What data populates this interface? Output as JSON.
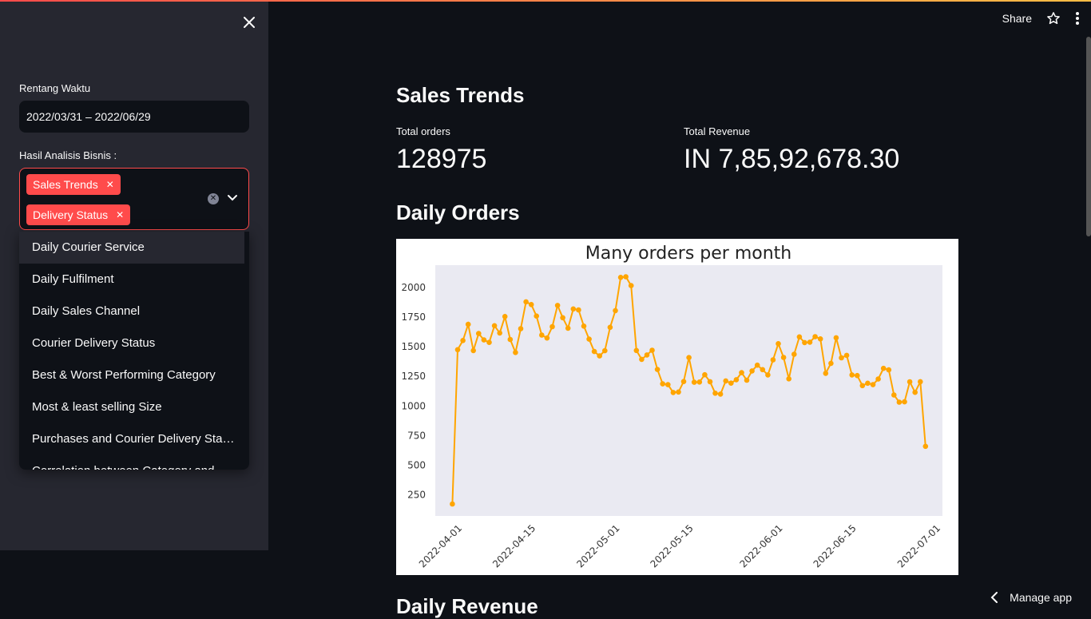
{
  "header": {
    "share_label": "Share"
  },
  "sidebar": {
    "date_label": "Rentang Waktu",
    "date_value": "2022/03/31 – 2022/06/29",
    "analysis_label": "Hasil Analisis Bisnis :",
    "selected_tags": [
      "Sales Trends",
      "Delivery Status"
    ],
    "options": [
      "Daily Courier Service",
      "Daily Fulfilment",
      "Daily Sales Channel",
      "Courier Delivery Status",
      "Best & Worst Performing Category",
      "Most & least selling Size",
      "Purchases and Courier Delivery Sta…",
      "Correlation between Category and"
    ]
  },
  "main": {
    "title": "Sales Trends",
    "metrics": [
      {
        "label": "Total orders",
        "value": "128975"
      },
      {
        "label": "Total Revenue",
        "value": "IN 7,85,92,678.30"
      }
    ],
    "daily_orders_heading": "Daily Orders",
    "daily_revenue_heading": "Daily Revenue"
  },
  "footer": {
    "manage_label": "Manage app"
  },
  "colors": {
    "accent": "#ff4b4b",
    "line": "#ffa500",
    "plot_bg": "#eaeaf2"
  },
  "chart_data": {
    "type": "line",
    "title": "Many orders per month",
    "xlabel": "",
    "ylabel": "",
    "x_ticks": [
      "2022-04-01",
      "2022-04-15",
      "2022-05-01",
      "2022-05-15",
      "2022-06-01",
      "2022-06-15",
      "2022-07-01"
    ],
    "y_ticks": [
      250,
      500,
      750,
      1000,
      1250,
      1500,
      1750,
      2000
    ],
    "ylim": [
      70,
      2190
    ],
    "x_start": "2022-03-31",
    "x_end": "2022-06-29",
    "grid": false,
    "series": [
      {
        "values": [
          171,
          1476,
          1553,
          1690,
          1468,
          1612,
          1558,
          1537,
          1678,
          1617,
          1756,
          1562,
          1452,
          1653,
          1880,
          1857,
          1760,
          1599,
          1574,
          1670,
          1850,
          1746,
          1657,
          1820,
          1812,
          1675,
          1565,
          1460,
          1423,
          1467,
          1665,
          1806,
          2087,
          2092,
          2017,
          1469,
          1394,
          1431,
          1471,
          1308,
          1187,
          1180,
          1114,
          1118,
          1206,
          1409,
          1200,
          1202,
          1264,
          1205,
          1108,
          1100,
          1212,
          1193,
          1222,
          1281,
          1218,
          1296,
          1345,
          1307,
          1262,
          1390,
          1526,
          1410,
          1229,
          1437,
          1584,
          1536,
          1539,
          1586,
          1567,
          1276,
          1360,
          1576,
          1407,
          1428,
          1262,
          1257,
          1172,
          1192,
          1180,
          1228,
          1318,
          1305,
          1093,
          1032,
          1035,
          1204,
          1115,
          1205,
          659
        ]
      }
    ]
  }
}
